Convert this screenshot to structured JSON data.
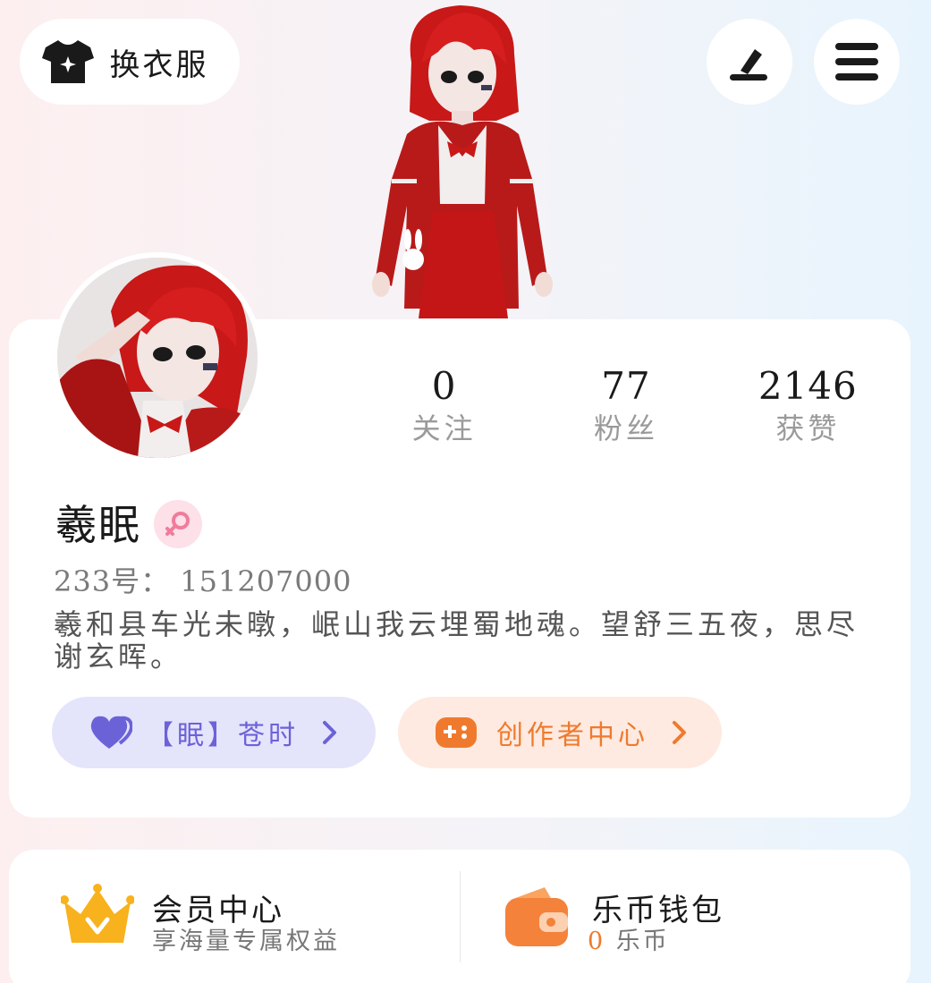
{
  "topbar": {
    "outfit_label": "换衣服",
    "outfit_icon": "tshirt-icon",
    "edit_icon": "pen-icon",
    "menu_icon": "hamburger-menu-icon"
  },
  "profile": {
    "stats": [
      {
        "value": "0",
        "label": "关注"
      },
      {
        "value": "77",
        "label": "粉丝"
      },
      {
        "value": "2146",
        "label": "获赞"
      }
    ],
    "username": "羲眠",
    "gender_icon": "female-symbol-icon",
    "uid_text": "233号： 151207000",
    "bio": "羲和县车光未暾，岷山我云埋蜀地魂。望舒三五夜，思尽谢玄晖。",
    "tags": [
      {
        "label": "【眠】苍时",
        "icon": "heart-icon",
        "color": "#6c62d8"
      },
      {
        "label": "创作者中心",
        "icon": "gamepad-icon",
        "color": "#ef7a2e"
      }
    ]
  },
  "services": {
    "vip": {
      "title": "会员中心",
      "subtitle": "享海量专属权益",
      "icon": "crown-icon"
    },
    "wallet": {
      "title": "乐币钱包",
      "balance": "0",
      "unit": "乐币",
      "icon": "wallet-icon"
    }
  },
  "colors": {
    "accent_purple": "#6c62d8",
    "accent_orange": "#ef7a2e",
    "crown_gold": "#f7b21d"
  }
}
